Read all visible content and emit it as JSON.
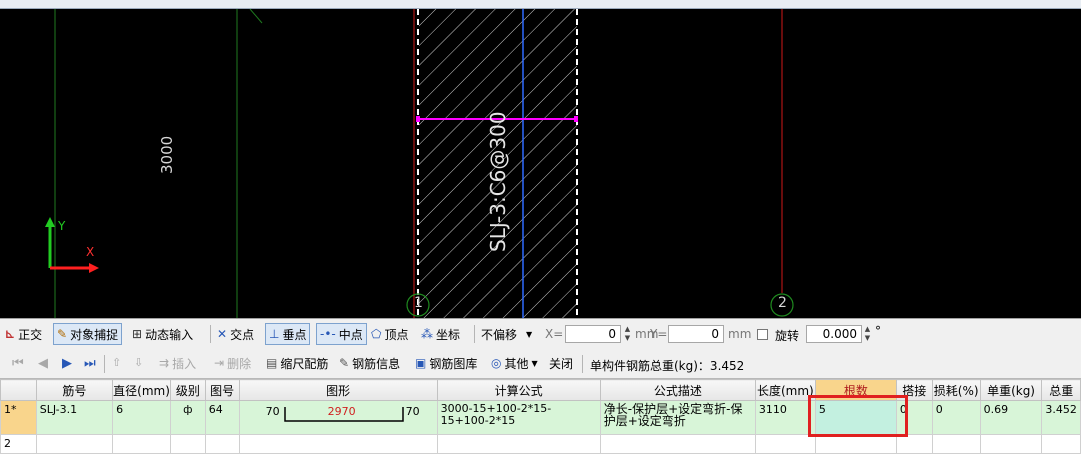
{
  "canvas": {
    "dimension_text": "3000",
    "rebar_label": "SLJ-3:C6@300",
    "axis_x_label": "X",
    "axis_y_label": "Y",
    "grid_markers": [
      "1",
      "2"
    ],
    "colors": {
      "background": "#000000",
      "axis_blue": "#2f6bff",
      "grid_red": "#d01818",
      "rebar_magenta": "#ff00ff",
      "green_line": "#1f7a1f"
    }
  },
  "snapbar": {
    "ortho": "正交",
    "object_snap": "对象捕捉",
    "dynamic_input": "动态输入",
    "intersection": "交点",
    "perpendicular": "垂点",
    "midpoint": "中点",
    "vertex": "顶点",
    "coordinate": "坐标",
    "offset_mode": "不偏移",
    "x_label": "X=",
    "x_value": "0",
    "x_unit": "mm",
    "y_label": "Y=",
    "y_value": "0",
    "y_unit": "mm",
    "rotate_label": "旋转",
    "rotate_value": "0.000",
    "degree_symbol": "°"
  },
  "rebarbar": {
    "insert": "插入",
    "delete": "删除",
    "scale_rebar": "缩尺配筋",
    "rebar_info": "钢筋信息",
    "rebar_library": "钢筋图库",
    "other": "其他",
    "close": "关闭",
    "total_weight": "单构件钢筋总重(kg)：3.452"
  },
  "table": {
    "columns": [
      "筋号",
      "直径(mm)",
      "级别",
      "图号",
      "图形",
      "计算公式",
      "公式描述",
      "长度(mm)",
      "根数",
      "搭接",
      "损耗(%)",
      "单重(kg)",
      "总重"
    ],
    "rows": [
      {
        "index": "1*",
        "bar_no": "SLJ-3.1",
        "diameter": "6",
        "grade": "ф",
        "shape_no": "64",
        "shape_left": "70",
        "shape_mid": "2970",
        "shape_right": "70",
        "formula": "3000-15+100-2*15-15+100-2*15",
        "description": "净长-保护层+设定弯折-保护层+设定弯折",
        "length": "3110",
        "count": "5",
        "lap": "0",
        "loss": "0",
        "unit_weight": "0.69",
        "total_weight": "3.452"
      },
      {
        "index": "2"
      }
    ]
  }
}
